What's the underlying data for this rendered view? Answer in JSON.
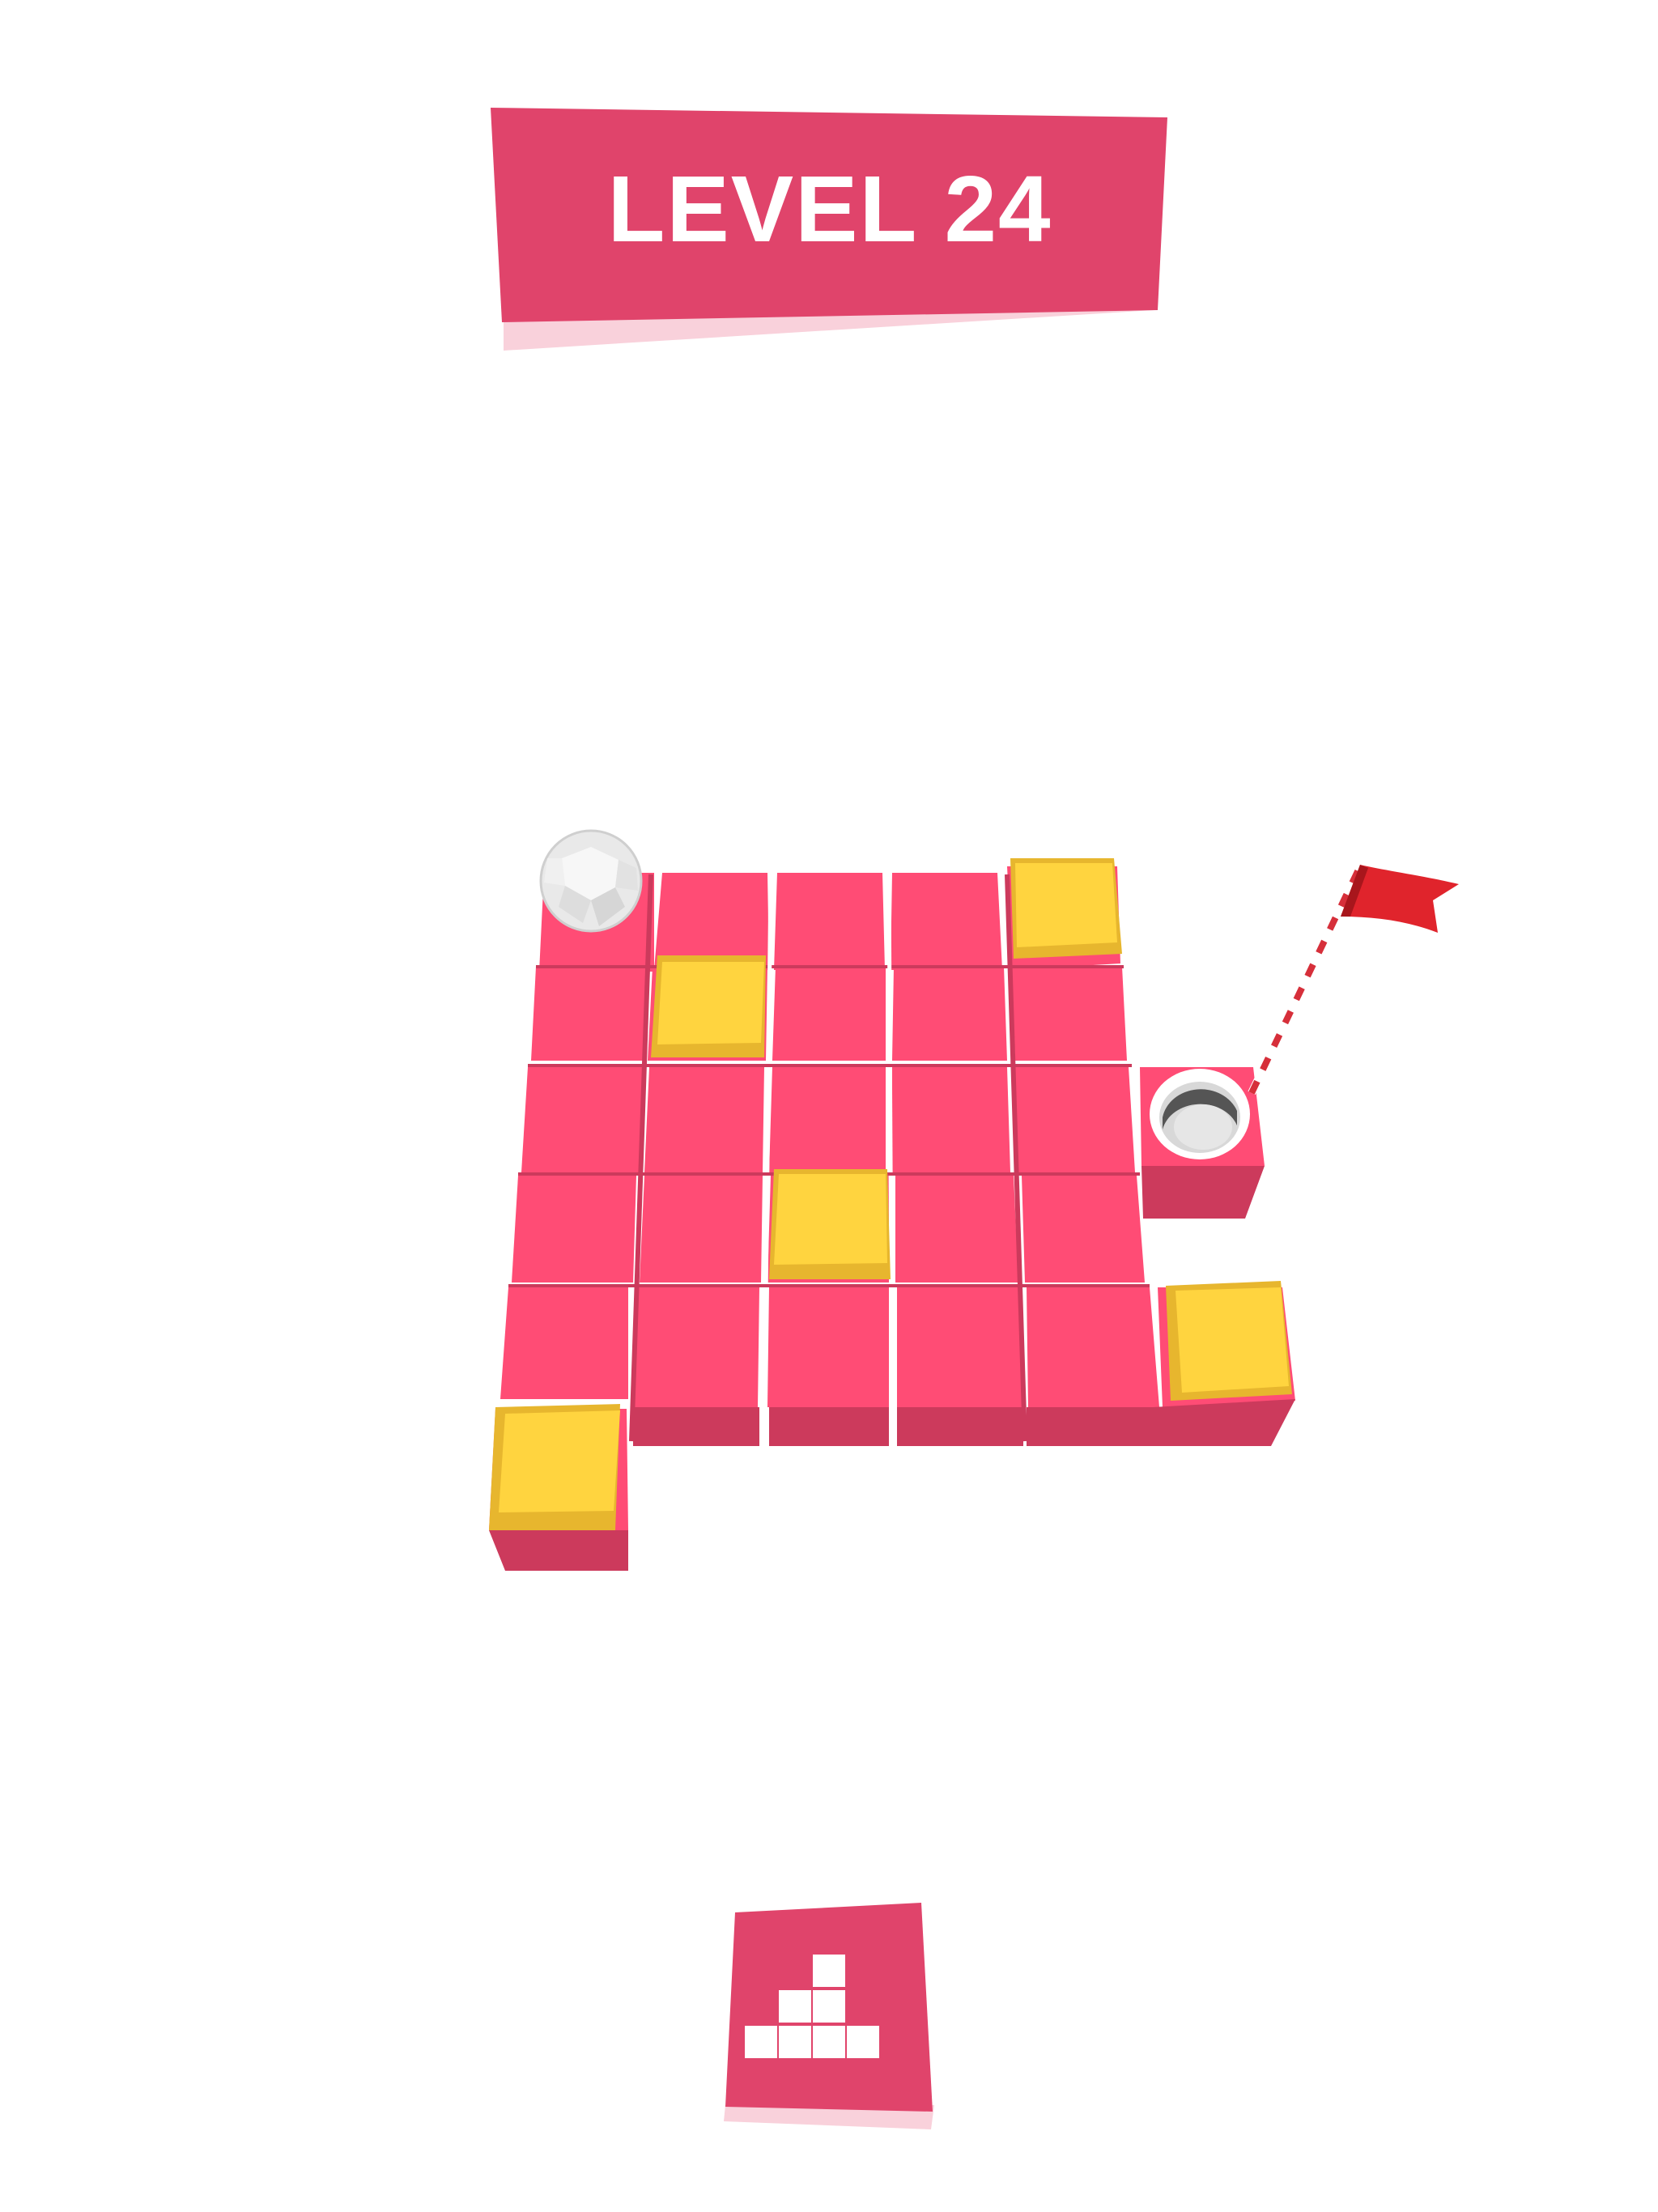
{
  "header": {
    "level_label": "LEVEL 24"
  },
  "board": {
    "colors": {
      "tile_top": "#ff4c75",
      "tile_side": "#cc3a5c",
      "yellow_top": "#ffd43f",
      "yellow_side": "#e7b62e",
      "banner": "#e0446b",
      "banner_shadow": "#f9d1db"
    },
    "yellow_blocks": [
      "r0c4",
      "r1c1",
      "r3c2",
      "r4c5",
      "r5c0"
    ],
    "ball": "r0c0",
    "hole": "r2c5",
    "flag_icon": "golf-flag-icon"
  },
  "footer": {
    "levels_button_icon": "level-select-blocks-icon"
  }
}
